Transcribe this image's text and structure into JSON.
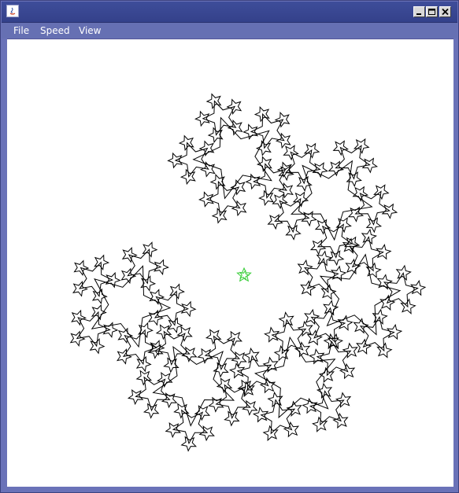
{
  "window": {
    "title": "",
    "title_bar_color": "#3e4d9a",
    "app_icon": "java-icon",
    "buttons": [
      "minimize-icon",
      "maximize-icon",
      "close-icon"
    ]
  },
  "menubar": {
    "items": [
      {
        "label": "File"
      },
      {
        "label": "Speed"
      },
      {
        "label": "View"
      }
    ]
  },
  "canvas": {
    "background": "#ffffff",
    "stroke_color": "#000000",
    "highlight_color": "#33cc33",
    "figure": "star-fractal"
  }
}
